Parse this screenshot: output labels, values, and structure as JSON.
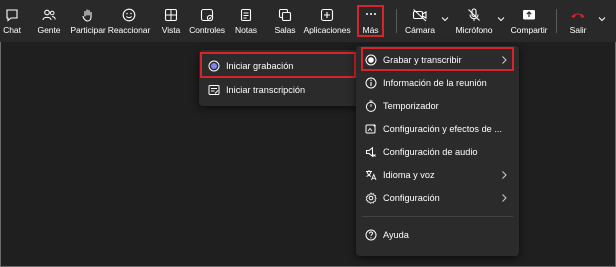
{
  "toolbar": {
    "items": [
      {
        "label": "Chat",
        "icon": "chat-icon"
      },
      {
        "label": "Gente",
        "icon": "people-icon"
      },
      {
        "label": "Participar",
        "icon": "raise-hand-icon"
      },
      {
        "label": "Reaccionar",
        "icon": "emoji-icon"
      },
      {
        "label": "Vista",
        "icon": "view-grid-icon"
      },
      {
        "label": "Controles",
        "icon": "controls-icon"
      },
      {
        "label": "Notas",
        "icon": "notes-icon"
      },
      {
        "label": "Salas",
        "icon": "rooms-icon"
      },
      {
        "label": "Aplicaciones",
        "icon": "apps-plus-icon"
      },
      {
        "label": "Más",
        "icon": "more-icon"
      },
      {
        "label": "Cámara",
        "icon": "camera-off-icon"
      },
      {
        "label": "Micrófono",
        "icon": "mic-off-icon"
      },
      {
        "label": "Compartir",
        "icon": "share-icon"
      },
      {
        "label": "Salir",
        "icon": "hang-up-icon"
      }
    ]
  },
  "submenu": {
    "items": [
      {
        "label": "Iniciar grabación",
        "icon": "record-icon"
      },
      {
        "label": "Iniciar transcripción",
        "icon": "transcript-icon"
      }
    ]
  },
  "more_menu": {
    "items": [
      {
        "label": "Grabar y transcribir",
        "icon": "record-icon",
        "has_submenu": true
      },
      {
        "label": "Información de la reunión",
        "icon": "info-icon",
        "has_submenu": false
      },
      {
        "label": "Temporizador",
        "icon": "timer-icon",
        "has_submenu": false
      },
      {
        "label": "Configuración y efectos de ...",
        "icon": "effects-icon",
        "has_submenu": false
      },
      {
        "label": "Configuración de audio",
        "icon": "speaker-icon",
        "has_submenu": false
      },
      {
        "label": "Idioma y voz",
        "icon": "language-icon",
        "has_submenu": true
      },
      {
        "label": "Configuración",
        "icon": "gear-icon",
        "has_submenu": true
      },
      {
        "label": "Ayuda",
        "icon": "help-icon",
        "has_submenu": false
      }
    ]
  },
  "colors": {
    "highlight_border": "#d7232b",
    "hangup_red": "#d7232b",
    "toolbar_bg": "#292929",
    "menu_bg": "#2b2b2b",
    "record_dot": "#7f85f5"
  }
}
